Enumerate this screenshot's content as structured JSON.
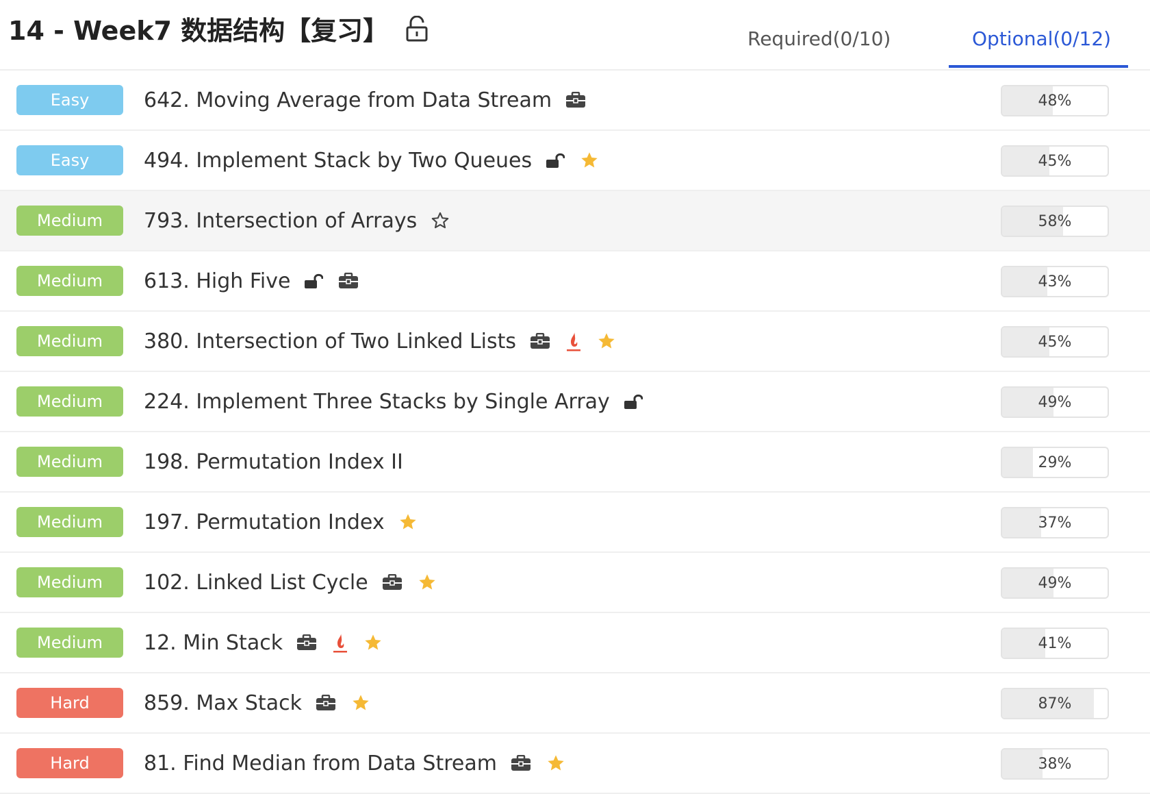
{
  "header": {
    "title": "14 - Week7 数据结构【复习】",
    "title_icon": "unlock-icon",
    "tabs": [
      {
        "label": "Required(0/10)",
        "active": false
      },
      {
        "label": "Optional(0/12)",
        "active": true
      }
    ]
  },
  "colors": {
    "accent": "#2b58d6",
    "easy": "#7ecbef",
    "medium": "#9cce6a",
    "hard": "#ee7362",
    "star": "#f5b935",
    "flame": "#e8503a"
  },
  "problems": [
    {
      "difficulty": "Easy",
      "title": "642. Moving Average from Data Stream",
      "icons": [
        "briefcase-icon"
      ],
      "rate": "48%",
      "rate_value": 48,
      "highlighted": false
    },
    {
      "difficulty": "Easy",
      "title": "494. Implement Stack by Two Queues",
      "icons": [
        "unlock-icon",
        "star-filled-icon"
      ],
      "rate": "45%",
      "rate_value": 45,
      "highlighted": false
    },
    {
      "difficulty": "Medium",
      "title": "793. Intersection of Arrays",
      "icons": [
        "star-outline-icon"
      ],
      "rate": "58%",
      "rate_value": 58,
      "highlighted": true
    },
    {
      "difficulty": "Medium",
      "title": "613. High Five",
      "icons": [
        "unlock-icon",
        "briefcase-icon"
      ],
      "rate": "43%",
      "rate_value": 43,
      "highlighted": false
    },
    {
      "difficulty": "Medium",
      "title": "380. Intersection of Two Linked Lists",
      "icons": [
        "briefcase-icon",
        "flame-icon",
        "star-filled-icon"
      ],
      "rate": "45%",
      "rate_value": 45,
      "highlighted": false
    },
    {
      "difficulty": "Medium",
      "title": "224. Implement Three Stacks by Single Array",
      "icons": [
        "unlock-icon"
      ],
      "rate": "49%",
      "rate_value": 49,
      "highlighted": false
    },
    {
      "difficulty": "Medium",
      "title": "198. Permutation Index II",
      "icons": [],
      "rate": "29%",
      "rate_value": 29,
      "highlighted": false
    },
    {
      "difficulty": "Medium",
      "title": "197. Permutation Index",
      "icons": [
        "star-filled-icon"
      ],
      "rate": "37%",
      "rate_value": 37,
      "highlighted": false
    },
    {
      "difficulty": "Medium",
      "title": "102. Linked List Cycle",
      "icons": [
        "briefcase-icon",
        "star-filled-icon"
      ],
      "rate": "49%",
      "rate_value": 49,
      "highlighted": false
    },
    {
      "difficulty": "Medium",
      "title": "12. Min Stack",
      "icons": [
        "briefcase-icon",
        "flame-icon",
        "star-filled-icon"
      ],
      "rate": "41%",
      "rate_value": 41,
      "highlighted": false
    },
    {
      "difficulty": "Hard",
      "title": "859. Max Stack",
      "icons": [
        "briefcase-icon",
        "star-filled-icon"
      ],
      "rate": "87%",
      "rate_value": 87,
      "highlighted": false
    },
    {
      "difficulty": "Hard",
      "title": "81. Find Median from Data Stream",
      "icons": [
        "briefcase-icon",
        "star-filled-icon"
      ],
      "rate": "38%",
      "rate_value": 38,
      "highlighted": false
    }
  ]
}
